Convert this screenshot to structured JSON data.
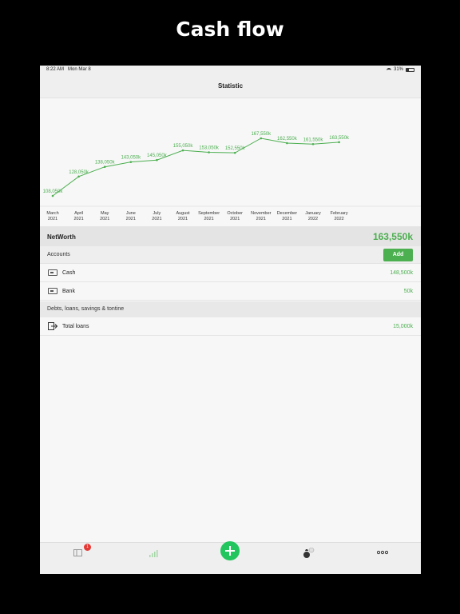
{
  "promo": {
    "title": "Cash flow"
  },
  "status_bar": {
    "time": "8:22 AM",
    "date": "Mon Mar 8",
    "battery": "31%"
  },
  "nav": {
    "title": "Statistic"
  },
  "chart_data": {
    "type": "line",
    "categories": [
      "March 2021",
      "April 2021",
      "May 2021",
      "June 2021",
      "July 2021",
      "August 2021",
      "September 2021",
      "October 2021",
      "November 2021",
      "December 2021",
      "January 2022",
      "February 2022"
    ],
    "x_label_lines": [
      [
        "March",
        "2021"
      ],
      [
        "April",
        "2021"
      ],
      [
        "May",
        "2021"
      ],
      [
        "June",
        "2021"
      ],
      [
        "July",
        "2021"
      ],
      [
        "August",
        "2021"
      ],
      [
        "September",
        "2021"
      ],
      [
        "October",
        "2021"
      ],
      [
        "November",
        "2021"
      ],
      [
        "December",
        "2021"
      ],
      [
        "January",
        "2022"
      ],
      [
        "February",
        "2022"
      ]
    ],
    "values": [
      108050,
      128050,
      138050,
      143050,
      145050,
      155050,
      153050,
      152550,
      167550,
      162550,
      161550,
      163550
    ],
    "data_labels": [
      "108,050k",
      "128,050k",
      "138,050k",
      "143,050k",
      "145,050k",
      "155,050k",
      "153,050k",
      "152,550k",
      "167,550k",
      "162,550k",
      "161,550k",
      "163,550k"
    ],
    "line_color": "#4caf50",
    "grid": false
  },
  "networth": {
    "label": "NetWorth",
    "value": "163,550k"
  },
  "accounts": {
    "header": "Accounts",
    "add_label": "Add",
    "items": [
      {
        "name": "Cash",
        "value": "148,500k",
        "icon": "wallet-icon"
      },
      {
        "name": "Bank",
        "value": "50k",
        "icon": "bank-card-icon"
      }
    ]
  },
  "debts": {
    "header": "Debts, loans, savings & tontine",
    "items": [
      {
        "name": "Total loans",
        "value": "15,000k",
        "icon": "loan-exit-icon"
      }
    ]
  },
  "tab_bar": {
    "badge_count": "1",
    "items": [
      "transactions-icon",
      "statistics-icon",
      "add-icon",
      "savings-bag-icon",
      "more-icon"
    ]
  },
  "colors": {
    "accent": "#4caf50",
    "badge": "#e53935"
  }
}
